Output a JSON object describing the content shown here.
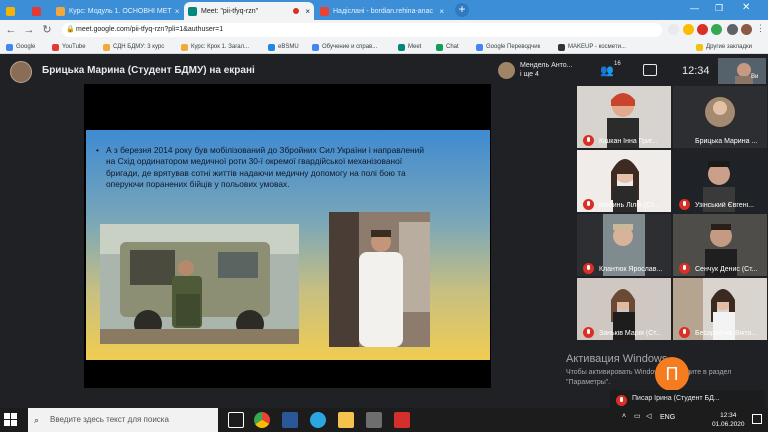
{
  "tabs": [
    {
      "title": "",
      "active": false
    },
    {
      "title": "",
      "active": false
    },
    {
      "title": "Курс: Модуль 1. ОСНОВНІ МЕТ",
      "active": false
    },
    {
      "title": "Meet: \"pii-tfyq-rzn\"",
      "active": true
    },
    {
      "title": "Надіслані - bordian.rehina-anac",
      "active": false
    }
  ],
  "url": "meet.google.com/pii-tfyq-rzn?pli=1&authuser=1",
  "bookmarks": [
    "Google",
    "YouTube",
    "СДН БДМУ: 3 курс",
    "Курс: Крок 1. Загал...",
    "eBSMU",
    "Обучение и справ...",
    "Meet",
    "Chat",
    "Google Переводчик",
    "MAKEUP - космети...",
    "Другие закладки"
  ],
  "meet": {
    "presenter": "Брицька Марина (Студент БДМУ) на екрані",
    "self_name": "Мендель Анто...",
    "self_sub": "і ще 4",
    "participants_count": "16",
    "clock": "12:34",
    "corner_label": "Ви",
    "tiles": [
      {
        "name": "Кішкан Інна Григ..."
      },
      {
        "name": "Брицька Марина ..."
      },
      {
        "name": "Молинь Лілія (Ст..."
      },
      {
        "name": "Узінський Євгені..."
      },
      {
        "name": "Клантюк Ярослав..."
      },
      {
        "name": "Сенчук Денис (Ст..."
      },
      {
        "name": "Заньків Марія (Ст..."
      },
      {
        "name": "Бесарабчик Вікто..."
      }
    ],
    "bottom_name": "Писар Ірина (Студент БД...",
    "fab_letter": "П"
  },
  "slide": {
    "text": "А з березня 2014 року був мобілізований до Збройних Сил України і направлений на Схід ординатором медичної роти 30-ї окремої гвардійської механізованої бригади, де врятував сотні життів надаючи медичну допомогу на полі бою та оперуючи поранених бійців у польових умовах."
  },
  "activation": {
    "title": "Активация Windows",
    "sub": "Чтобы активировать Windows, перейдите в раздел \"Параметры\"."
  },
  "taskbar": {
    "search_placeholder": "Введите здесь текст для поиска",
    "lang": "ENG",
    "time": "12:34",
    "date": "01.06.2020"
  }
}
